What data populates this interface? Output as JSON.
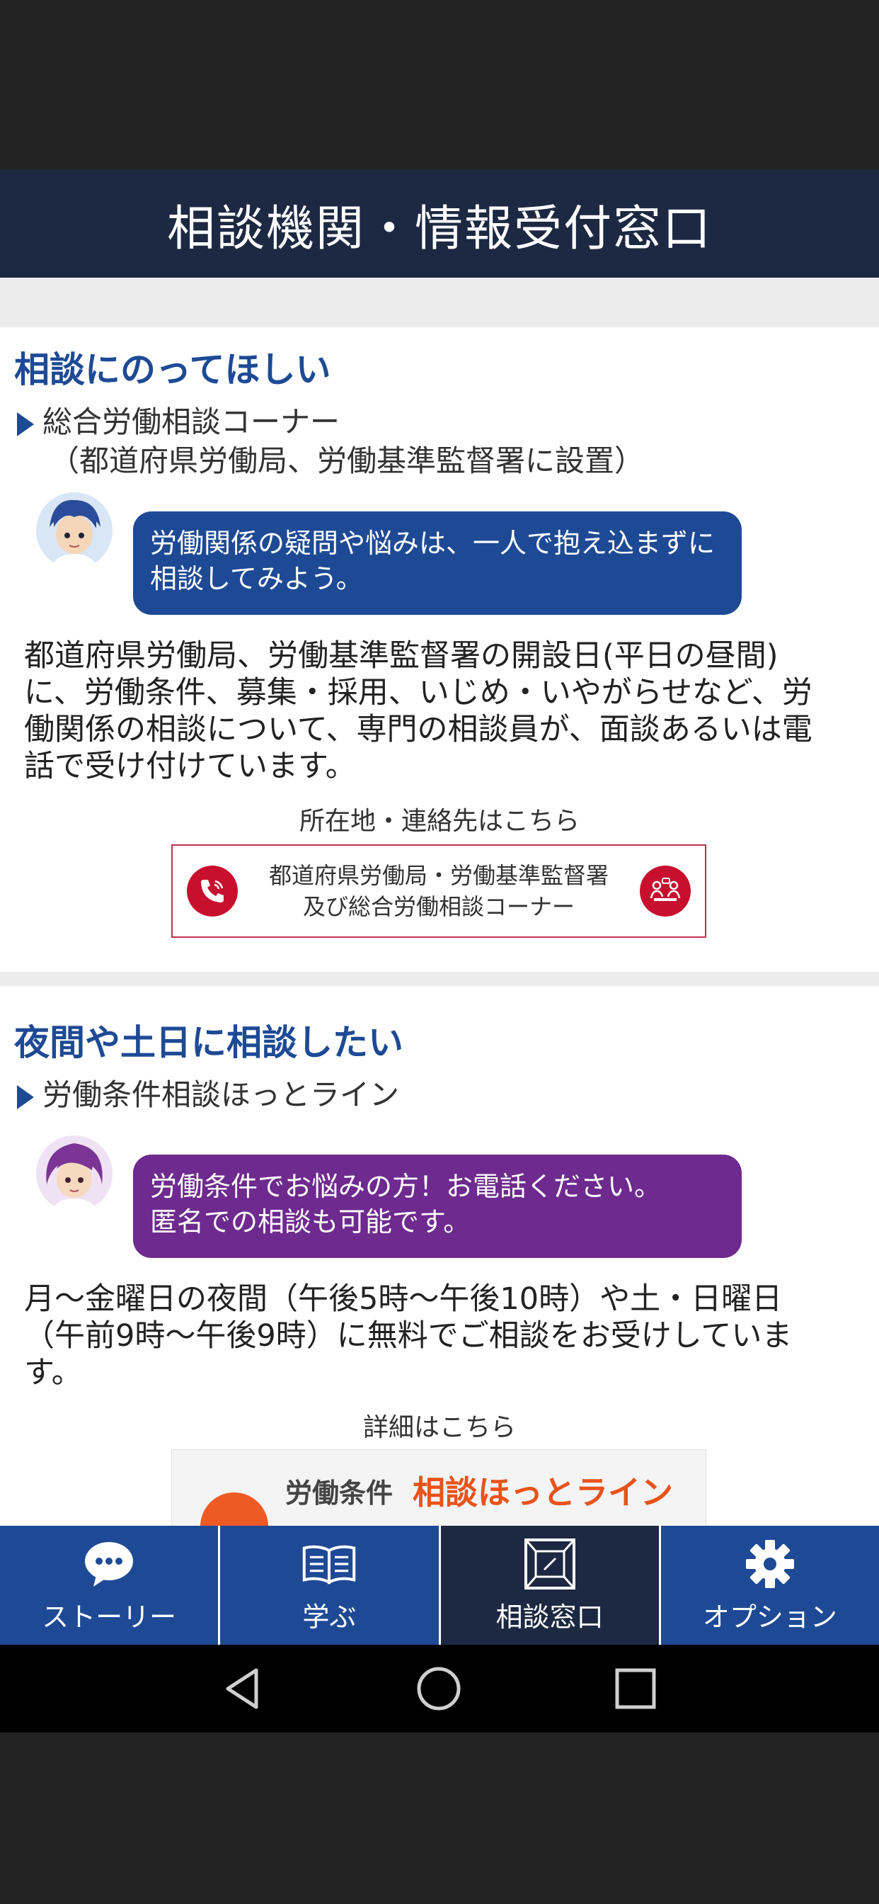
{
  "header": {
    "title": "相談機関・情報受付窓口"
  },
  "section1": {
    "title": "相談にのってほしい",
    "subtitle": "総合労働相談コーナー",
    "subnote": "（都道府県労働局、労働基準監督署に設置）",
    "bubble": "労働関係の疑問や悩みは、一人で抱え込まずに相談してみよう。",
    "body": "都道府県労働局、労働基準監督署の開設日(平日の昼間)に、労働条件、募集・採用、いじめ・いやがらせなど、労働関係の相談について、専門の相談員が、面談あるいは電話で受け付けています。",
    "link_caption": "所在地・連絡先はこちら",
    "link_line1": "都道府県労働局・労働基準監督署",
    "link_line2": "及び総合労働相談コーナー"
  },
  "section2": {
    "title": "夜間や土日に相談したい",
    "subtitle": "労働条件相談ほっとライン",
    "bubble_line1": "労働条件でお悩みの方！お電話ください。",
    "bubble_line2": "匿名での相談も可能です。",
    "body": "月～金曜日の夜間（午後5時～午後10時）や土・日曜日（午前9時～午後9時）に無料でご相談をお受けしています。",
    "link_caption": "詳細はこちら",
    "banner_part1": "労働条件",
    "banner_part2": "相談ほっとライン"
  },
  "tabs": [
    {
      "label": "ストーリー",
      "icon": "chat-bubble-icon",
      "active": false
    },
    {
      "label": "学ぶ",
      "icon": "open-book-icon",
      "active": false
    },
    {
      "label": "相談窓口",
      "icon": "window-icon",
      "active": true
    },
    {
      "label": "オプション",
      "icon": "gear-icon",
      "active": false
    }
  ],
  "colors": {
    "header": "#1d2942",
    "accent_blue": "#1e4a95",
    "accent_purple": "#6e2a8e",
    "link_red": "#c8102e"
  }
}
